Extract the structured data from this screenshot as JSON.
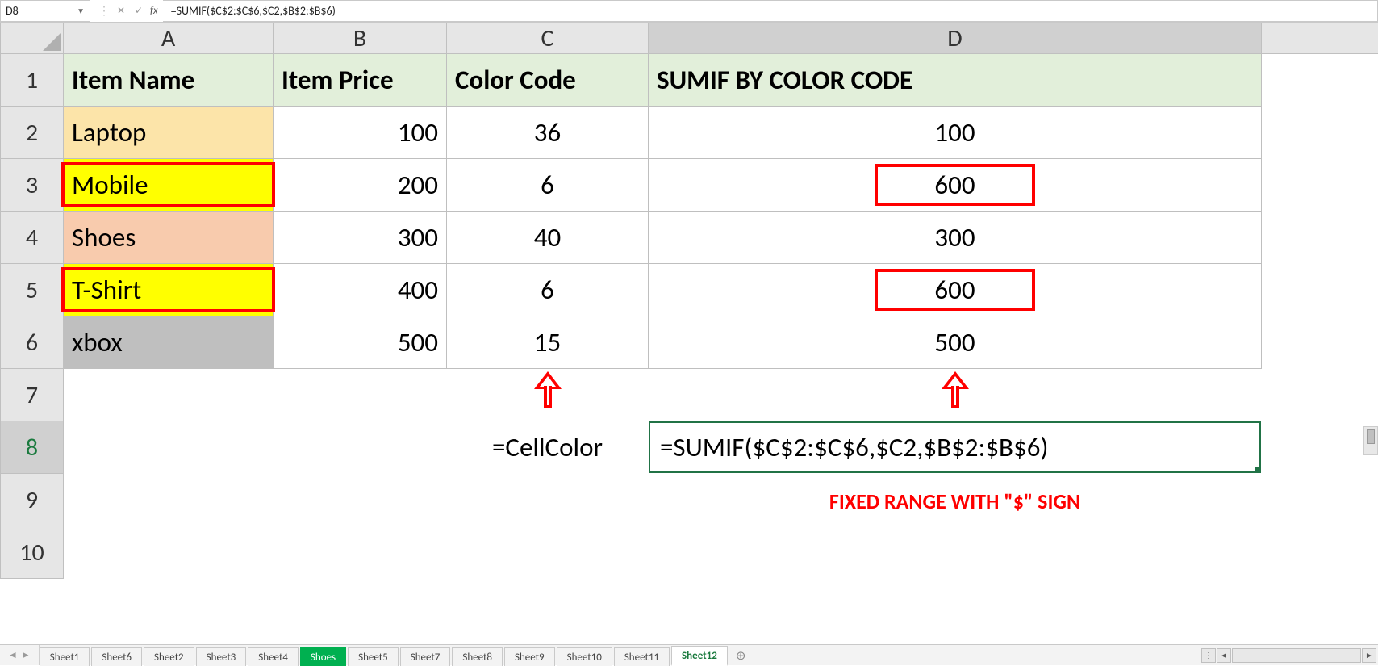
{
  "name_box": "D8",
  "formula": "=SUMIF($C$2:$C$6,$C2,$B$2:$B$6)",
  "columns": [
    "A",
    "B",
    "C",
    "D"
  ],
  "row_nums": [
    "1",
    "2",
    "3",
    "4",
    "5",
    "6",
    "7",
    "8",
    "9",
    "10"
  ],
  "headers": {
    "A": "Item Name",
    "B": "Item Price",
    "C": "Color Code",
    "D": "SUMIF BY COLOR CODE"
  },
  "rows": [
    {
      "item": "Laptop",
      "price": "100",
      "code": "36",
      "sum": "100",
      "bg": "bg-orange",
      "hlItem": false,
      "hlSum": false
    },
    {
      "item": "Mobile",
      "price": "200",
      "code": "6",
      "sum": "600",
      "bg": "bg-yellow",
      "hlItem": true,
      "hlSum": true
    },
    {
      "item": "Shoes",
      "price": "300",
      "code": "40",
      "sum": "300",
      "bg": "bg-peach",
      "hlItem": false,
      "hlSum": false
    },
    {
      "item": "T-Shirt",
      "price": "400",
      "code": "6",
      "sum": "600",
      "bg": "bg-yellow",
      "hlItem": true,
      "hlSum": true
    },
    {
      "item": "xbox",
      "price": "500",
      "code": "15",
      "sum": "500",
      "bg": "bg-gray",
      "hlItem": false,
      "hlSum": false
    }
  ],
  "row8": {
    "C": "=CellColor",
    "D": "=SUMIF($C$2:$C$6,$C2,$B$2:$B$6)"
  },
  "annotation": "FIXED RANGE WITH \"$\" SIGN",
  "tabs": [
    "Sheet1",
    "Sheet6",
    "Sheet2",
    "Sheet3",
    "Sheet4",
    "Shoes",
    "Sheet5",
    "Sheet7",
    "Sheet8",
    "Sheet9",
    "Sheet10",
    "Sheet11",
    "Sheet12"
  ],
  "tab_green": "Shoes",
  "tab_active": "Sheet12",
  "colwidths": {
    "rowhdr": 78,
    "A": 260,
    "B": 215,
    "C": 250,
    "D": 760
  },
  "rowheights": {
    "colhdr": 60,
    "data": 65
  }
}
